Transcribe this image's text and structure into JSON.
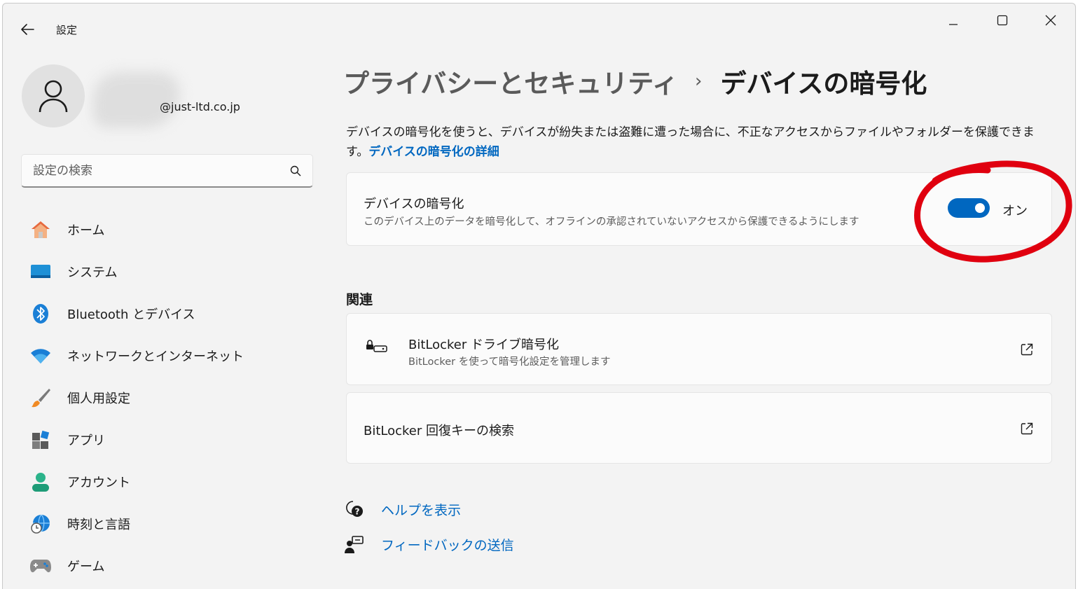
{
  "window": {
    "app_title": "設定"
  },
  "profile": {
    "email": "@just-ltd.co.jp"
  },
  "search": {
    "placeholder": "設定の検索"
  },
  "sidebar": {
    "items": [
      {
        "label": "ホーム",
        "icon": "home-icon"
      },
      {
        "label": "システム",
        "icon": "system-icon"
      },
      {
        "label": "Bluetooth とデバイス",
        "icon": "bluetooth-icon"
      },
      {
        "label": "ネットワークとインターネット",
        "icon": "wifi-icon"
      },
      {
        "label": "個人用設定",
        "icon": "brush-icon"
      },
      {
        "label": "アプリ",
        "icon": "apps-icon"
      },
      {
        "label": "アカウント",
        "icon": "account-icon"
      },
      {
        "label": "時刻と言語",
        "icon": "time-language-icon"
      },
      {
        "label": "ゲーム",
        "icon": "gamepad-icon"
      }
    ]
  },
  "breadcrumb": {
    "parent": "プライバシーとセキュリティ",
    "separator": "›",
    "current": "デバイスの暗号化"
  },
  "description": {
    "text": "デバイスの暗号化を使うと、デバイスが紛失または盗難に遭った場合に、不正なアクセスからファイルやフォルダーを保護できます。",
    "link": "デバイスの暗号化の詳細"
  },
  "encryption_card": {
    "title": "デバイスの暗号化",
    "subtitle": "このデバイス上のデータを暗号化して、オフラインの承認されていないアクセスから保護できるようにします",
    "toggle_state": "オン"
  },
  "related": {
    "title": "関連",
    "bitlocker_title": "BitLocker ドライブ暗号化",
    "bitlocker_sub": "BitLocker を使って暗号化設定を管理します",
    "recovery_title": "BitLocker 回復キーの検索"
  },
  "help": {
    "get_help": "ヘルプを表示",
    "feedback": "フィードバックの送信"
  },
  "colors": {
    "accent": "#0067c0",
    "annotation": "#e0000f",
    "background": "#f3f3f3"
  }
}
